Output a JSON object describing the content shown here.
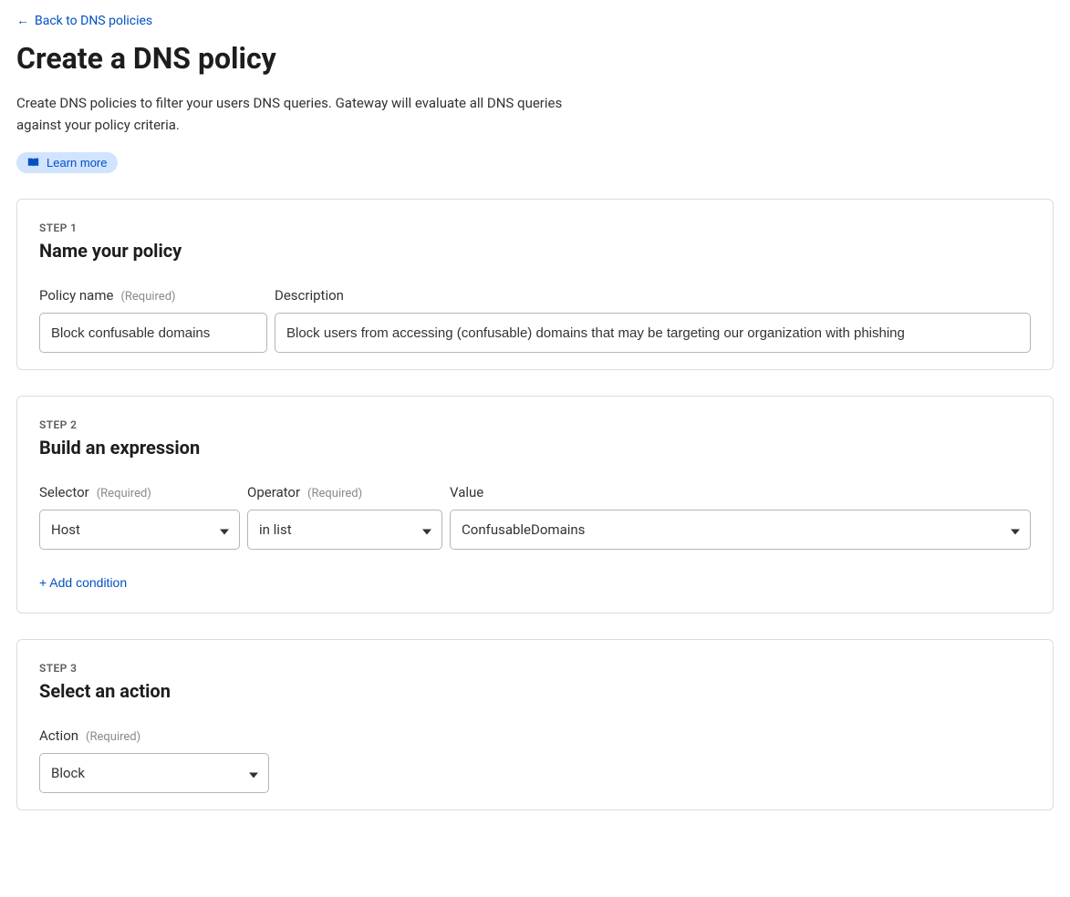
{
  "back_link": "Back to DNS policies",
  "page_title": "Create a DNS policy",
  "page_description": "Create DNS policies to filter your users DNS queries. Gateway will evaluate all DNS queries against your policy criteria.",
  "learn_more": "Learn more",
  "required_tag": "(Required)",
  "step1": {
    "step_label": "STEP 1",
    "title": "Name your policy",
    "policy_name_label": "Policy name",
    "policy_name_value": "Block confusable domains",
    "description_label": "Description",
    "description_value": "Block users from accessing (confusable) domains that may be targeting our organization with phishing"
  },
  "step2": {
    "step_label": "STEP 2",
    "title": "Build an expression",
    "selector_label": "Selector",
    "selector_value": "Host",
    "operator_label": "Operator",
    "operator_value": "in list",
    "value_label": "Value",
    "value_value": "ConfusableDomains",
    "add_condition": "+ Add condition"
  },
  "step3": {
    "step_label": "STEP 3",
    "title": "Select an action",
    "action_label": "Action",
    "action_value": "Block"
  }
}
